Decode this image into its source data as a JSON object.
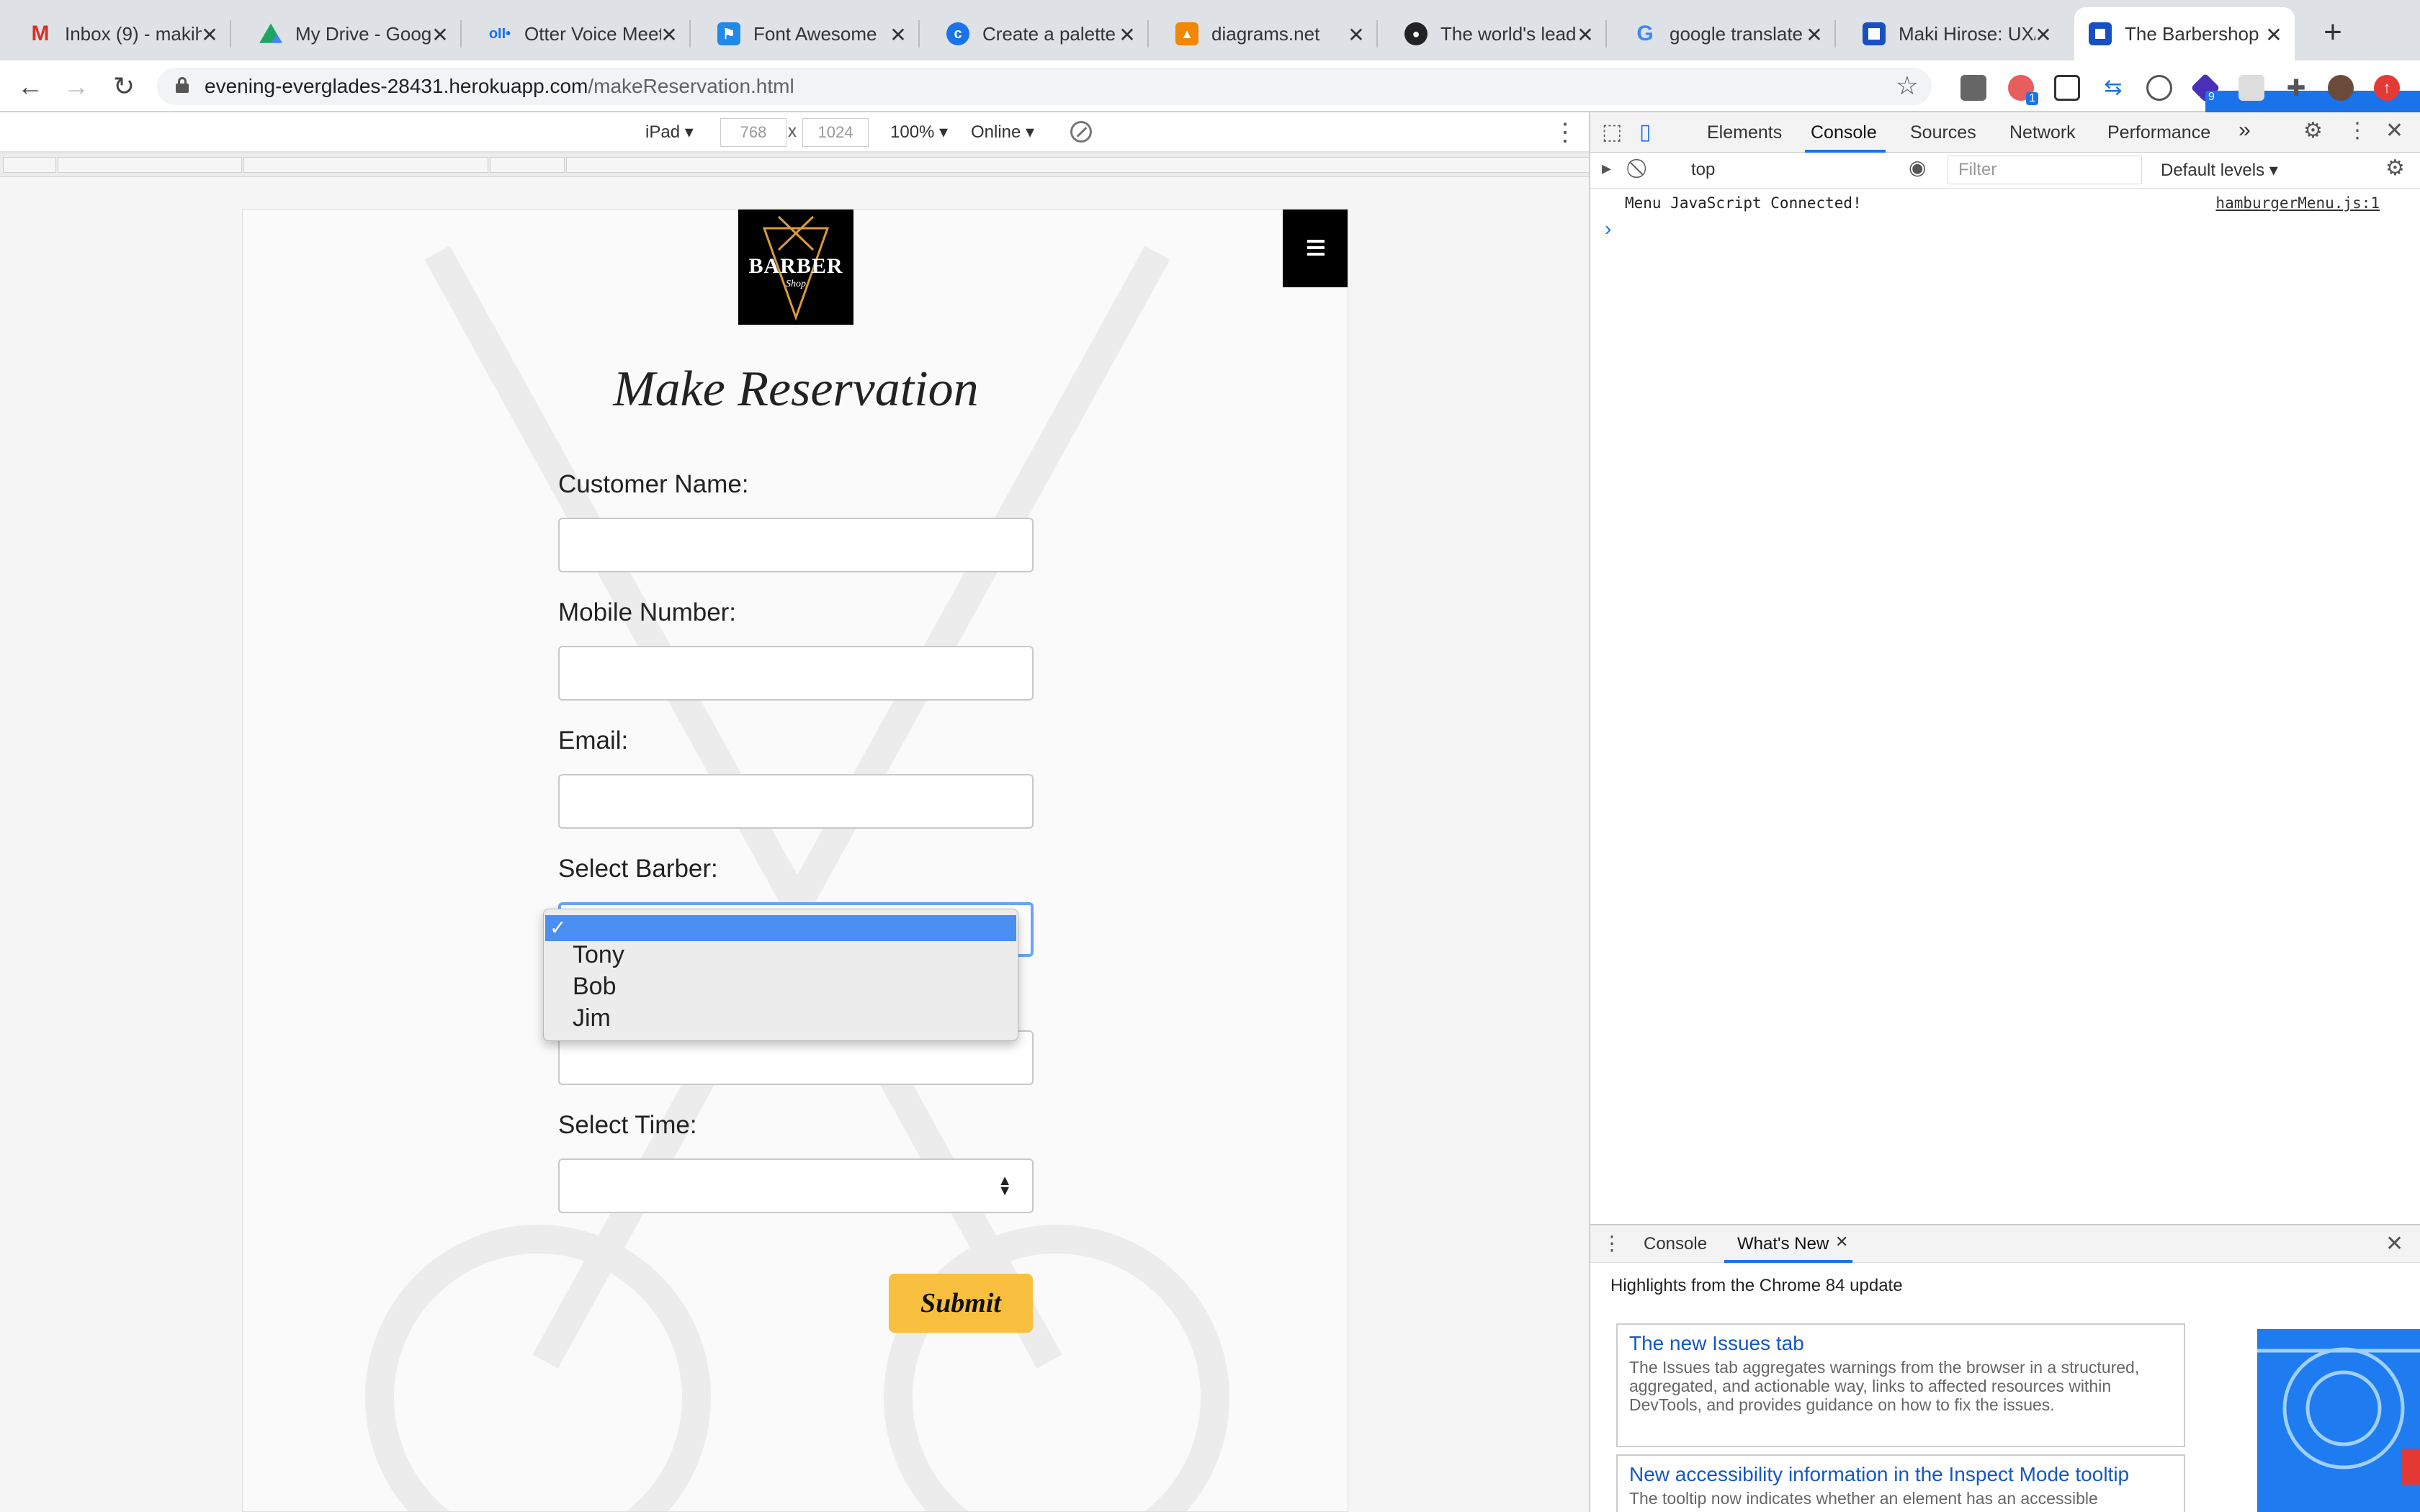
{
  "browser": {
    "tabs": [
      {
        "title": "Inbox (9) - makih",
        "icon": "gmail-icon",
        "color": "#d93025"
      },
      {
        "title": "My Drive - Google",
        "icon": "google-drive-icon",
        "color": "#1fa463"
      },
      {
        "title": "Otter Voice Meeti",
        "icon": "otter-icon",
        "color": "#1a73e8"
      },
      {
        "title": "Font Awesome",
        "icon": "font-awesome-flag-icon",
        "color": "#228ae6"
      },
      {
        "title": "Create a palette",
        "icon": "coolors-icon",
        "color": "#1a73e8"
      },
      {
        "title": "diagrams.net",
        "icon": "diagrams-icon",
        "color": "#f08705"
      },
      {
        "title": "The world's lead",
        "icon": "github-icon",
        "color": "#222222"
      },
      {
        "title": "google translate",
        "icon": "google-icon",
        "color": "#4285f4"
      },
      {
        "title": "Maki Hirose: UX/",
        "icon": "site-icon",
        "color": "#1a4fc4"
      },
      {
        "title": "The Barbershop",
        "icon": "site-icon",
        "color": "#1a4fc4",
        "active": true
      }
    ],
    "url_host": "evening-everglades-28431.herokuapp.com",
    "url_path": "/makeReservation.html",
    "extension_badges": {
      "ext_two": "1",
      "ext_eight": "9"
    }
  },
  "device_toolbar": {
    "device": "iPad ▾",
    "width": "768",
    "times": "x",
    "height": "1024",
    "zoom": "100% ▾",
    "network": "Online ▾"
  },
  "page": {
    "logo_text": "BARBER",
    "logo_subtext": "Shop",
    "title": "Make Reservation",
    "labels": {
      "name": "Customer Name:",
      "mobile": "Mobile Number:",
      "email": "Email:",
      "barber": "Select Barber:",
      "time": "Select Time:"
    },
    "submit": "Submit",
    "barber_dropdown": {
      "selected_mark": "✓",
      "options": [
        "Tony",
        "Bob",
        "Jim"
      ]
    }
  },
  "devtools": {
    "tabs": [
      "Elements",
      "Console",
      "Sources",
      "Network",
      "Performance"
    ],
    "more": "»",
    "context": "top",
    "filter_placeholder": "Filter",
    "levels": "Default levels ▾",
    "console_message": "Menu JavaScript Connected!",
    "console_source": "hamburgerMenu.js:1",
    "prompt": "›",
    "drawer_tabs": [
      "Console",
      "What's New"
    ],
    "highlights": "Highlights from the Chrome 84 update",
    "cards": [
      {
        "title": "The new Issues tab",
        "body": "The Issues tab aggregates warnings from the browser in a structured, aggregated, and actionable way, links to affected resources within DevTools, and provides guidance on how to fix the issues."
      },
      {
        "title": "New accessibility information in the Inspect Mode tooltip",
        "body": "The tooltip now indicates whether an element has an accessible"
      }
    ]
  }
}
